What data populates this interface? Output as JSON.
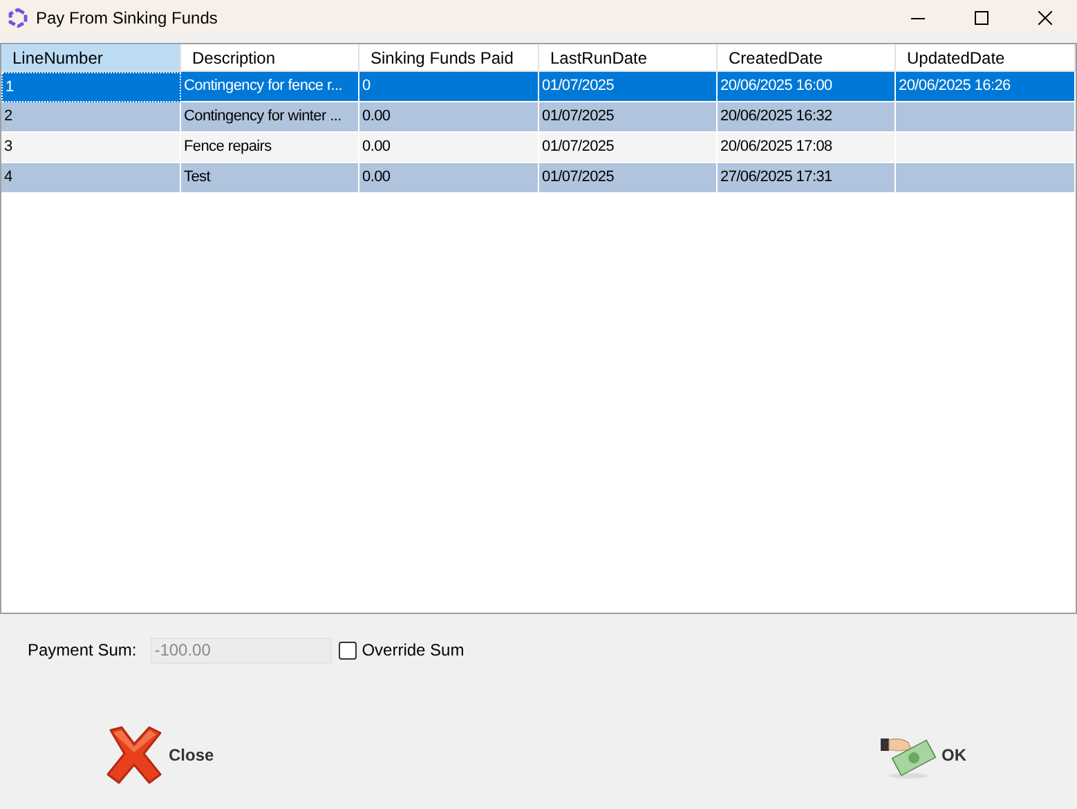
{
  "window": {
    "title": "Pay From Sinking Funds"
  },
  "table": {
    "columns": [
      {
        "label": "LineNumber",
        "selected": true
      },
      {
        "label": "Description",
        "selected": false
      },
      {
        "label": "Sinking Funds Paid",
        "selected": false
      },
      {
        "label": "LastRunDate",
        "selected": false
      },
      {
        "label": "CreatedDate",
        "selected": false
      },
      {
        "label": "UpdatedDate",
        "selected": false
      }
    ],
    "rows": [
      {
        "selected": true,
        "cells": [
          "1",
          "Contingency for fence r...",
          "0",
          "01/07/2025",
          "20/06/2025 16:00",
          "20/06/2025 16:26"
        ]
      },
      {
        "selected": false,
        "cells": [
          "2",
          "Contingency for winter ...",
          "0.00",
          "01/07/2025",
          "20/06/2025 16:32",
          ""
        ]
      },
      {
        "selected": false,
        "cells": [
          "3",
          "Fence repairs",
          "0.00",
          "01/07/2025",
          "20/06/2025 17:08",
          ""
        ]
      },
      {
        "selected": false,
        "cells": [
          "4",
          "Test",
          "0.00",
          "01/07/2025",
          "27/06/2025 17:31",
          ""
        ]
      }
    ]
  },
  "payment_sum": {
    "label": "Payment Sum:",
    "value": "-100.00",
    "disabled": true
  },
  "override_sum": {
    "label": "Override Sum",
    "checked": false
  },
  "buttons": [
    {
      "kind": "close",
      "label": "Close"
    },
    {
      "kind": "ok",
      "label": "OK"
    }
  ]
}
